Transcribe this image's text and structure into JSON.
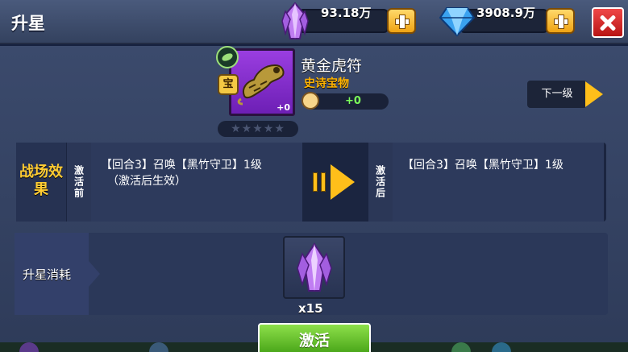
{
  "header": {
    "title": "升星",
    "resources": [
      {
        "name": "crystal",
        "value": "93.18万",
        "icon": "purple-crystal-icon"
      },
      {
        "name": "diamond",
        "value": "3908.9万",
        "icon": "blue-diamond-icon"
      }
    ],
    "close_icon": "close-icon"
  },
  "item": {
    "name": "黄金虎符",
    "rarity": "史诗宝物",
    "badge": "宝",
    "level_badge": "+0",
    "power_value": "+0",
    "stars": "★★★★★",
    "star_count": 0,
    "icon": "golden-tiger-talisman-icon"
  },
  "next_level": {
    "label": "下一级"
  },
  "effect": {
    "section_label": "战场效果",
    "before_tag": "激活前",
    "after_tag": "激活后",
    "before_text": "【回合3】召唤【黑竹守卫】1级",
    "before_note": "（激活后生效）",
    "after_text": "【回合3】召唤【黑竹守卫】1级"
  },
  "cost": {
    "label": "升星消耗",
    "item_icon": "purple-crystal-icon",
    "quantity": "x15"
  },
  "actions": {
    "activate_label": "激活"
  },
  "colors": {
    "accent_gold": "#ffbf1a",
    "rarity_orange": "#ffb300",
    "activate_green": "#6cc832",
    "close_red": "#e33434",
    "item_purple": "#8a34d4"
  }
}
